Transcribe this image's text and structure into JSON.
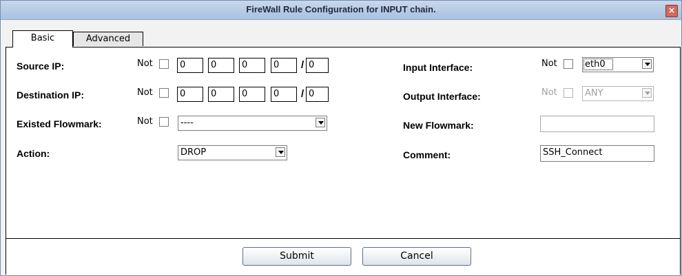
{
  "window": {
    "title": "FireWall Rule Configuration for INPUT chain.",
    "close_symbol": "×"
  },
  "tabs": [
    {
      "label": "Basic",
      "active": true
    },
    {
      "label": "Advanced",
      "active": false
    }
  ],
  "not_label": "Not",
  "ip_separator": "/",
  "form": {
    "source_ip": {
      "label": "Source IP:",
      "octets": [
        "0",
        "0",
        "0",
        "0"
      ],
      "mask": "0"
    },
    "destination_ip": {
      "label": "Destination IP:",
      "octets": [
        "0",
        "0",
        "0",
        "0"
      ],
      "mask": "0"
    },
    "existed_flowmark": {
      "label": "Existed Flowmark:",
      "value": "----"
    },
    "action": {
      "label": "Action:",
      "value": "DROP"
    },
    "input_interface": {
      "label": "Input Interface:",
      "value": "eth0"
    },
    "output_interface": {
      "label": "Output Interface:",
      "value": "ANY"
    },
    "new_flowmark": {
      "label": "New Flowmark:",
      "value": ""
    },
    "comment": {
      "label": "Comment:",
      "value": "SSH_Connect"
    }
  },
  "buttons": {
    "submit": "Submit",
    "cancel": "Cancel"
  }
}
